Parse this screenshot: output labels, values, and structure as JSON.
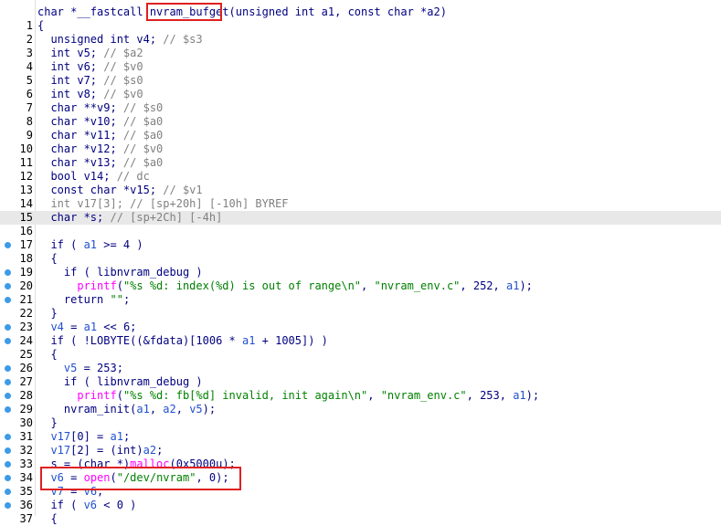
{
  "editor": {
    "lines": [
      {
        "num": "",
        "dot": false,
        "hl": false,
        "tokens": [
          [
            "plain",
            "char *__fastcall "
          ],
          [
            "plain",
            "nvram_bufget"
          ],
          [
            "plain",
            "(unsigned int a1, const char *a2)"
          ]
        ]
      },
      {
        "num": "1",
        "dot": false,
        "hl": false,
        "tokens": [
          [
            "plain",
            "{"
          ]
        ]
      },
      {
        "num": "2",
        "dot": false,
        "hl": false,
        "tokens": [
          [
            "plain",
            "  unsigned int v4; "
          ],
          [
            "comment",
            "// $s3"
          ]
        ]
      },
      {
        "num": "3",
        "dot": false,
        "hl": false,
        "tokens": [
          [
            "plain",
            "  int v5; "
          ],
          [
            "comment",
            "// $a2"
          ]
        ]
      },
      {
        "num": "4",
        "dot": false,
        "hl": false,
        "tokens": [
          [
            "plain",
            "  int v6; "
          ],
          [
            "comment",
            "// $v0"
          ]
        ]
      },
      {
        "num": "5",
        "dot": false,
        "hl": false,
        "tokens": [
          [
            "plain",
            "  int v7; "
          ],
          [
            "comment",
            "// $s0"
          ]
        ]
      },
      {
        "num": "6",
        "dot": false,
        "hl": false,
        "tokens": [
          [
            "plain",
            "  int v8; "
          ],
          [
            "comment",
            "// $v0"
          ]
        ]
      },
      {
        "num": "7",
        "dot": false,
        "hl": false,
        "tokens": [
          [
            "plain",
            "  char **v9; "
          ],
          [
            "comment",
            "// $s0"
          ]
        ]
      },
      {
        "num": "8",
        "dot": false,
        "hl": false,
        "tokens": [
          [
            "plain",
            "  char *v10; "
          ],
          [
            "comment",
            "// $a0"
          ]
        ]
      },
      {
        "num": "9",
        "dot": false,
        "hl": false,
        "tokens": [
          [
            "plain",
            "  char *v11; "
          ],
          [
            "comment",
            "// $a0"
          ]
        ]
      },
      {
        "num": "10",
        "dot": false,
        "hl": false,
        "tokens": [
          [
            "plain",
            "  char *v12; "
          ],
          [
            "comment",
            "// $v0"
          ]
        ]
      },
      {
        "num": "11",
        "dot": false,
        "hl": false,
        "tokens": [
          [
            "plain",
            "  char *v13; "
          ],
          [
            "comment",
            "// $a0"
          ]
        ]
      },
      {
        "num": "12",
        "dot": false,
        "hl": false,
        "tokens": [
          [
            "plain",
            "  bool v14; "
          ],
          [
            "comment",
            "// dc"
          ]
        ]
      },
      {
        "num": "13",
        "dot": false,
        "hl": false,
        "tokens": [
          [
            "plain",
            "  const char *v15; "
          ],
          [
            "comment",
            "// $v1"
          ]
        ]
      },
      {
        "num": "14",
        "dot": false,
        "hl": false,
        "tokens": [
          [
            "gray",
            "  int v17[3]; // [sp+20h] [-10h] BYREF"
          ]
        ]
      },
      {
        "num": "15",
        "dot": false,
        "hl": true,
        "tokens": [
          [
            "plain",
            "  char *s; "
          ],
          [
            "comment",
            "// [sp+2Ch] [-4h]"
          ]
        ]
      },
      {
        "num": "16",
        "dot": false,
        "hl": false,
        "tokens": []
      },
      {
        "num": "17",
        "dot": true,
        "hl": false,
        "tokens": [
          [
            "plain",
            "  if ( "
          ],
          [
            "var",
            "a1"
          ],
          [
            "plain",
            " >= 4 )"
          ]
        ]
      },
      {
        "num": "18",
        "dot": false,
        "hl": false,
        "tokens": [
          [
            "plain",
            "  {"
          ]
        ]
      },
      {
        "num": "19",
        "dot": true,
        "hl": false,
        "tokens": [
          [
            "plain",
            "    if ( libnvram_debug )"
          ]
        ]
      },
      {
        "num": "20",
        "dot": true,
        "hl": false,
        "tokens": [
          [
            "func",
            "      printf"
          ],
          [
            "plain",
            "("
          ],
          [
            "string",
            "\"%s %d: index(%d) is out of range\\n\""
          ],
          [
            "plain",
            ", "
          ],
          [
            "string",
            "\"nvram_env.c\""
          ],
          [
            "plain",
            ", 252, "
          ],
          [
            "var",
            "a1"
          ],
          [
            "plain",
            ");"
          ]
        ]
      },
      {
        "num": "21",
        "dot": true,
        "hl": false,
        "tokens": [
          [
            "plain",
            "    return "
          ],
          [
            "string",
            "\"\""
          ],
          [
            "plain",
            ";"
          ]
        ]
      },
      {
        "num": "22",
        "dot": false,
        "hl": false,
        "tokens": [
          [
            "plain",
            "  }"
          ]
        ]
      },
      {
        "num": "23",
        "dot": true,
        "hl": false,
        "tokens": [
          [
            "plain",
            "  "
          ],
          [
            "var",
            "v4"
          ],
          [
            "plain",
            " = "
          ],
          [
            "var",
            "a1"
          ],
          [
            "plain",
            " << 6;"
          ]
        ]
      },
      {
        "num": "24",
        "dot": true,
        "hl": false,
        "tokens": [
          [
            "plain",
            "  if ( !LOBYTE((&fdata)[1006 * "
          ],
          [
            "var",
            "a1"
          ],
          [
            "plain",
            " + 1005]) )"
          ]
        ]
      },
      {
        "num": "25",
        "dot": false,
        "hl": false,
        "tokens": [
          [
            "plain",
            "  {"
          ]
        ]
      },
      {
        "num": "26",
        "dot": true,
        "hl": false,
        "tokens": [
          [
            "plain",
            "    "
          ],
          [
            "var",
            "v5"
          ],
          [
            "plain",
            " = 253;"
          ]
        ]
      },
      {
        "num": "27",
        "dot": true,
        "hl": false,
        "tokens": [
          [
            "plain",
            "    if ( libnvram_debug )"
          ]
        ]
      },
      {
        "num": "28",
        "dot": true,
        "hl": false,
        "tokens": [
          [
            "func",
            "      printf"
          ],
          [
            "plain",
            "("
          ],
          [
            "string",
            "\"%s %d: fb[%d] invalid, init again\\n\""
          ],
          [
            "plain",
            ", "
          ],
          [
            "string",
            "\"nvram_env.c\""
          ],
          [
            "plain",
            ", 253, "
          ],
          [
            "var",
            "a1"
          ],
          [
            "plain",
            ");"
          ]
        ]
      },
      {
        "num": "29",
        "dot": true,
        "hl": false,
        "tokens": [
          [
            "plain",
            "    nvram_init("
          ],
          [
            "var",
            "a1"
          ],
          [
            "plain",
            ", "
          ],
          [
            "var",
            "a2"
          ],
          [
            "plain",
            ", "
          ],
          [
            "var",
            "v5"
          ],
          [
            "plain",
            ");"
          ]
        ]
      },
      {
        "num": "30",
        "dot": false,
        "hl": false,
        "tokens": [
          [
            "plain",
            "  }"
          ]
        ]
      },
      {
        "num": "31",
        "dot": true,
        "hl": false,
        "tokens": [
          [
            "plain",
            "  "
          ],
          [
            "var",
            "v17"
          ],
          [
            "plain",
            "[0] = "
          ],
          [
            "var",
            "a1"
          ],
          [
            "plain",
            ";"
          ]
        ]
      },
      {
        "num": "32",
        "dot": true,
        "hl": false,
        "tokens": [
          [
            "plain",
            "  "
          ],
          [
            "var",
            "v17"
          ],
          [
            "plain",
            "[2] = (int)"
          ],
          [
            "var",
            "a2"
          ],
          [
            "plain",
            ";"
          ]
        ]
      },
      {
        "num": "33",
        "dot": true,
        "hl": false,
        "tokens": [
          [
            "plain",
            "  s = (char *)"
          ],
          [
            "func",
            "malloc"
          ],
          [
            "plain",
            "(0x5000u);"
          ]
        ]
      },
      {
        "num": "34",
        "dot": true,
        "hl": false,
        "tokens": [
          [
            "plain",
            "  "
          ],
          [
            "var",
            "v6"
          ],
          [
            "plain",
            " = "
          ],
          [
            "func",
            "open"
          ],
          [
            "plain",
            "("
          ],
          [
            "string",
            "\"/dev/nvram\""
          ],
          [
            "plain",
            ", 0);"
          ]
        ]
      },
      {
        "num": "35",
        "dot": true,
        "hl": false,
        "tokens": [
          [
            "plain",
            "  "
          ],
          [
            "var",
            "v7"
          ],
          [
            "plain",
            " = "
          ],
          [
            "var",
            "v6"
          ],
          [
            "plain",
            ";"
          ]
        ]
      },
      {
        "num": "36",
        "dot": true,
        "hl": false,
        "tokens": [
          [
            "plain",
            "  if ( "
          ],
          [
            "var",
            "v6"
          ],
          [
            "plain",
            " < 0 )"
          ]
        ]
      },
      {
        "num": "37",
        "dot": false,
        "hl": false,
        "tokens": [
          [
            "plain",
            "  {"
          ]
        ]
      }
    ]
  },
  "colors": {
    "plain": "#000080",
    "comment": "#808080",
    "var": "#2050d0",
    "string": "#008000",
    "func": "#ff00ff",
    "highlight": "#e8e8e8",
    "annotation": "#e02020"
  }
}
